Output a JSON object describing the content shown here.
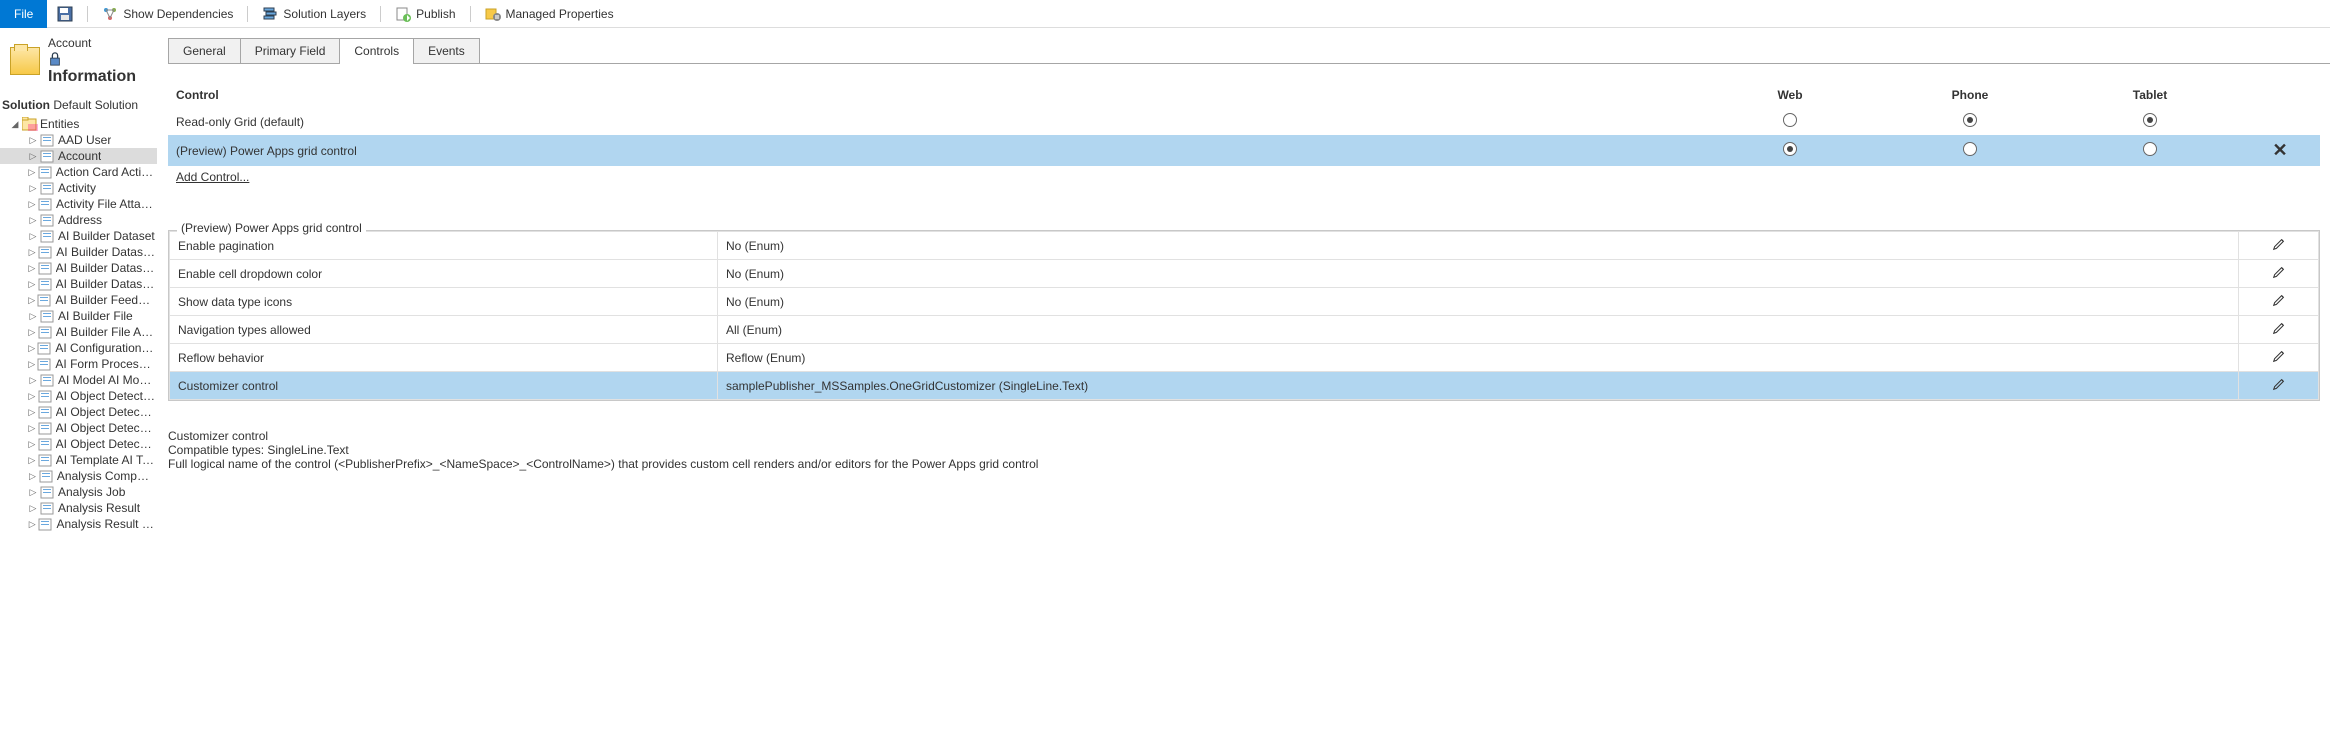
{
  "toolbar": {
    "file": "File",
    "show_dep": "Show Dependencies",
    "solution_layers": "Solution Layers",
    "publish": "Publish",
    "managed_props": "Managed Properties"
  },
  "header": {
    "entity": "Account",
    "form": "Information"
  },
  "solution": {
    "prefix": "Solution",
    "name": "Default Solution"
  },
  "tree": {
    "root": "Entities",
    "items": [
      {
        "label": "AAD User"
      },
      {
        "label": "Account",
        "selected": true
      },
      {
        "label": "Action Card Action Card"
      },
      {
        "label": "Activity"
      },
      {
        "label": "Activity File Attachment"
      },
      {
        "label": "Address"
      },
      {
        "label": "AI Builder Dataset"
      },
      {
        "label": "AI Builder Dataset File"
      },
      {
        "label": "AI Builder Dataset Rec..."
      },
      {
        "label": "AI Builder Datasets Co..."
      },
      {
        "label": "AI Builder Feedback Lo..."
      },
      {
        "label": "AI Builder File"
      },
      {
        "label": "AI Builder File Attache..."
      },
      {
        "label": "AI Configuration AI Con..."
      },
      {
        "label": "AI Form Processing Do..."
      },
      {
        "label": "AI Model AI Model"
      },
      {
        "label": "AI Object Detection Bo..."
      },
      {
        "label": "AI Object Detection Im..."
      },
      {
        "label": "AI Object Detection Im..."
      },
      {
        "label": "AI Object Detection La..."
      },
      {
        "label": "AI Template AI Template"
      },
      {
        "label": "Analysis Component"
      },
      {
        "label": "Analysis Job"
      },
      {
        "label": "Analysis Result"
      },
      {
        "label": "Analysis Result Detail"
      }
    ]
  },
  "tabs": {
    "general": "General",
    "primary_field": "Primary Field",
    "controls": "Controls",
    "events": "Events"
  },
  "controls_table": {
    "headers": {
      "control": "Control",
      "web": "Web",
      "phone": "Phone",
      "tablet": "Tablet"
    },
    "rows": [
      {
        "name": "Read-only Grid (default)",
        "web": false,
        "phone": true,
        "tablet": true,
        "selected": false,
        "deletable": false
      },
      {
        "name": "(Preview) Power Apps grid control",
        "web": true,
        "phone": false,
        "tablet": false,
        "selected": true,
        "deletable": true
      }
    ],
    "add": "Add Control..."
  },
  "properties": {
    "legend": "(Preview) Power Apps grid control",
    "rows": [
      {
        "label": "Enable pagination",
        "value": "No (Enum)"
      },
      {
        "label": "Enable cell dropdown color",
        "value": "No (Enum)"
      },
      {
        "label": "Show data type icons",
        "value": "No (Enum)"
      },
      {
        "label": "Navigation types allowed",
        "value": "All (Enum)"
      },
      {
        "label": "Reflow behavior",
        "value": "Reflow (Enum)"
      },
      {
        "label": "Customizer control",
        "value": "samplePublisher_MSSamples.OneGridCustomizer (SingleLine.Text)",
        "selected": true
      }
    ]
  },
  "help": {
    "title": "Customizer control",
    "types": "Compatible types: SingleLine.Text",
    "desc": "Full logical name of the control (<PublisherPrefix>_<NameSpace>_<ControlName>) that provides custom cell renders and/or editors for the Power Apps grid control"
  }
}
